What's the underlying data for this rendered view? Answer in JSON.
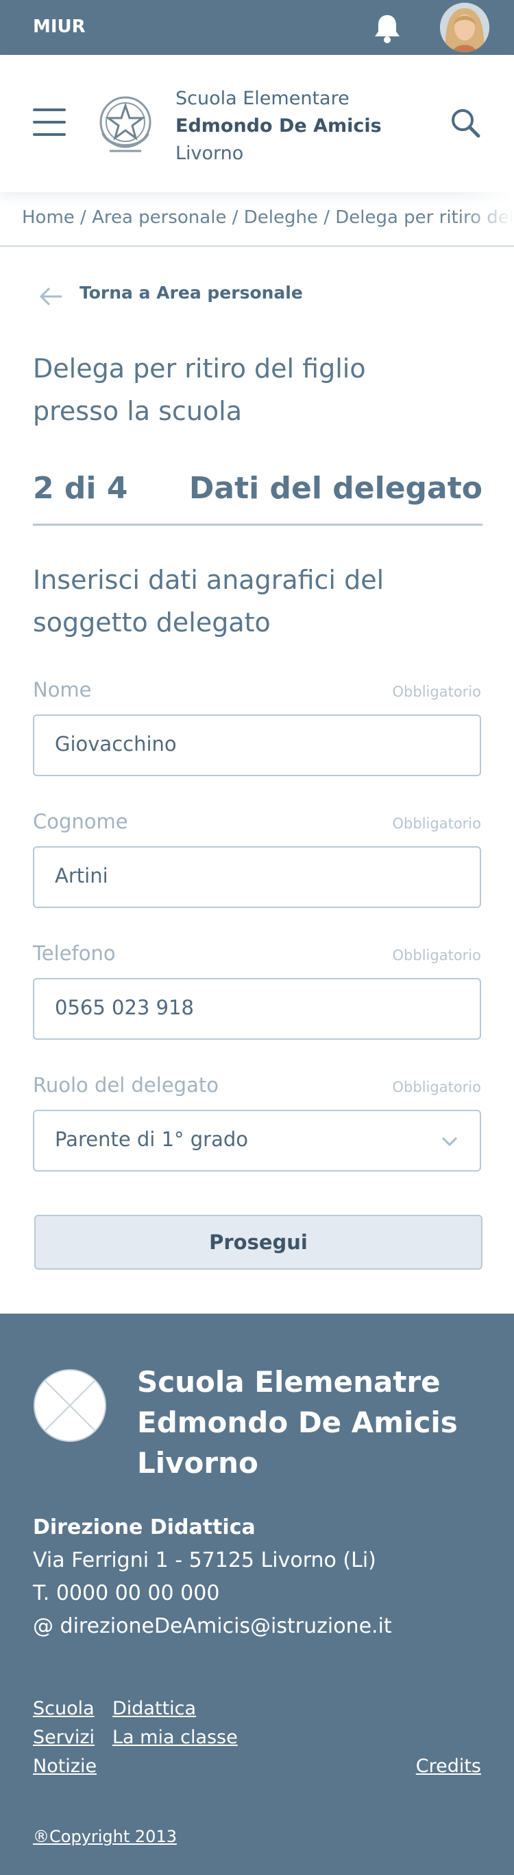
{
  "topbar": {
    "brand": "MIUR"
  },
  "header": {
    "school_line1": "Scuola Elementare",
    "school_line2": "Edmondo De Amicis",
    "school_line3": "Livorno"
  },
  "breadcrumb": {
    "text": "Home / Area personale / Deleghe / Delega per ritiro del figlio presso la scuola"
  },
  "back_link": {
    "label": "Torna a Area personale"
  },
  "page": {
    "title": "Delega per ritiro del figlio presso la scuola",
    "step_count": "2 di 4",
    "step_name": "Dati del delegato",
    "section_title": "Inserisci dati anagrafici del soggetto delegato"
  },
  "form": {
    "nome": {
      "label": "Nome",
      "required": "Obbligatorio",
      "value": "Giovacchino"
    },
    "cognome": {
      "label": "Cognome",
      "required": "Obbligatorio",
      "value": "Artini"
    },
    "telefono": {
      "label": "Telefono",
      "required": "Obbligatorio",
      "value": "0565 023 918"
    },
    "ruolo": {
      "label": "Ruolo del delegato",
      "required": "Obbligatorio",
      "value": "Parente di 1° grado"
    },
    "submit_label": "Prosegui"
  },
  "footer": {
    "name_line1": "Scuola Elemenatre",
    "name_line2": "Edmondo De Amicis",
    "name_line3": "Livorno",
    "direction": "Direzione Didattica",
    "address": "Via Ferrigni 1 - 57125 Livorno (Li)",
    "phone": "T. 0000 00 00 000",
    "email": "@ direzioneDeAmicis@istruzione.it",
    "links": {
      "scuola": "Scuola",
      "didattica": "Didattica",
      "servizi": "Servizi",
      "la_mia_classe": "La mia classe",
      "notizie": "Notizie",
      "credits": "Credits"
    },
    "copyright": "®Copyright 2013"
  },
  "colors": {
    "primary": "#5a768c",
    "text_dark": "#3e5569",
    "label": "#a3b3c0",
    "border": "#b9c8d4",
    "button_bg": "#e4eaf1"
  }
}
